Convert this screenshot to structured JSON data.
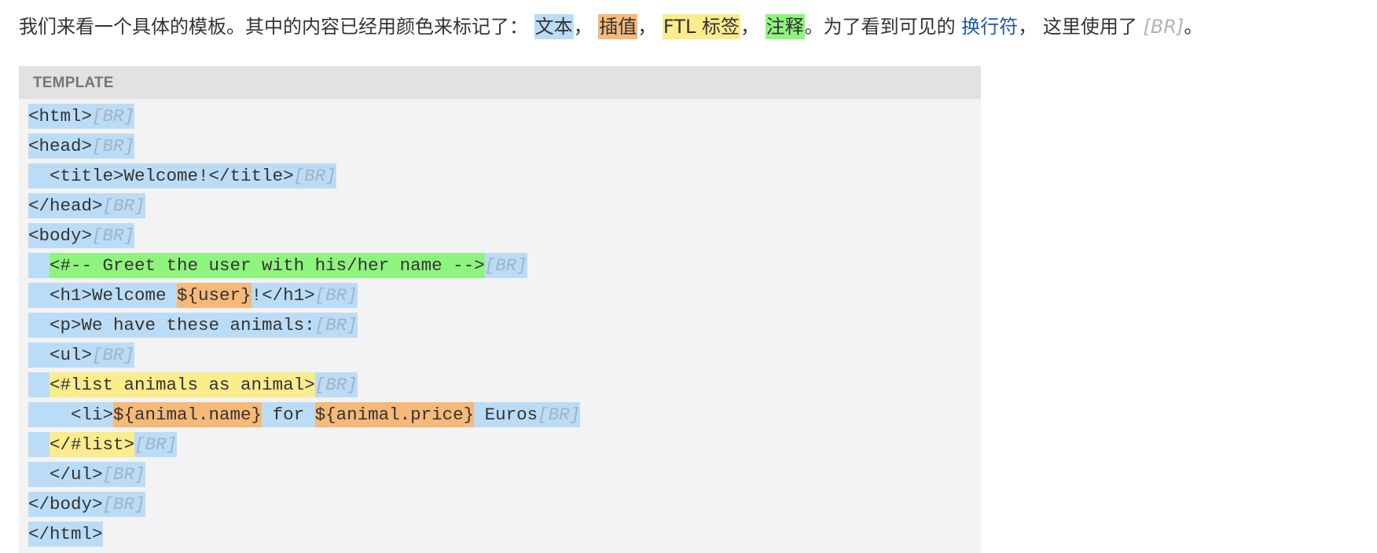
{
  "intro": {
    "prefix": "我们来看一个具体的模板。其中的内容已经用颜色来标记了：",
    "text_label": "文本",
    "sep1": "，",
    "interp_label": "插值",
    "sep2": "，",
    "ftl_label": "FTL 标签",
    "sep3": "，",
    "comment_label": "注释",
    "middle": "。为了看到可见的",
    "link_label": "换行符",
    "suffix": "， 这里使用了",
    "br_marker": "[BR]",
    "end": "。"
  },
  "template": {
    "header": "TEMPLATE",
    "br": "[BR]",
    "lines": [
      {
        "indent": "",
        "segs": [
          [
            "t",
            "<html>"
          ]
        ],
        "br": true
      },
      {
        "indent": "",
        "segs": [
          [
            "t",
            "<head>"
          ]
        ],
        "br": true
      },
      {
        "indent": "  ",
        "segs": [
          [
            "t",
            "<title>Welcome!</title>"
          ]
        ],
        "br": true
      },
      {
        "indent": "",
        "segs": [
          [
            "t",
            "</head>"
          ]
        ],
        "br": true
      },
      {
        "indent": "",
        "segs": [
          [
            "t",
            "<body>"
          ]
        ],
        "br": true
      },
      {
        "indent": "  ",
        "segs": [
          [
            "c",
            "<#-- Greet the user with his/her name -->"
          ]
        ],
        "br": true
      },
      {
        "indent": "  ",
        "segs": [
          [
            "t",
            "<h1>Welcome "
          ],
          [
            "i",
            "${user}"
          ],
          [
            "t",
            "!</h1>"
          ]
        ],
        "br": true
      },
      {
        "indent": "  ",
        "segs": [
          [
            "t",
            "<p>We have these animals:"
          ]
        ],
        "br": true
      },
      {
        "indent": "  ",
        "segs": [
          [
            "t",
            "<ul>"
          ]
        ],
        "br": true
      },
      {
        "indent": "  ",
        "segs": [
          [
            "f",
            "<#list animals as animal>"
          ]
        ],
        "br": true
      },
      {
        "indent": "    ",
        "segs": [
          [
            "t",
            "<li>"
          ],
          [
            "i",
            "${animal.name}"
          ],
          [
            "t",
            " for "
          ],
          [
            "i",
            "${animal.price}"
          ],
          [
            "t",
            " Euros"
          ]
        ],
        "br": true
      },
      {
        "indent": "  ",
        "segs": [
          [
            "f",
            "</#list>"
          ]
        ],
        "br": true
      },
      {
        "indent": "  ",
        "segs": [
          [
            "t",
            "</ul>"
          ]
        ],
        "br": true
      },
      {
        "indent": "",
        "segs": [
          [
            "t",
            "</body>"
          ]
        ],
        "br": true
      },
      {
        "indent": "",
        "segs": [
          [
            "t",
            "</html>"
          ]
        ],
        "br": false
      }
    ]
  },
  "colors": {
    "text": "#bbdcf6",
    "interpolation": "#f5b979",
    "ftl_tag": "#fbec8d",
    "comment": "#8ff47e",
    "link": "#1d56b5"
  }
}
